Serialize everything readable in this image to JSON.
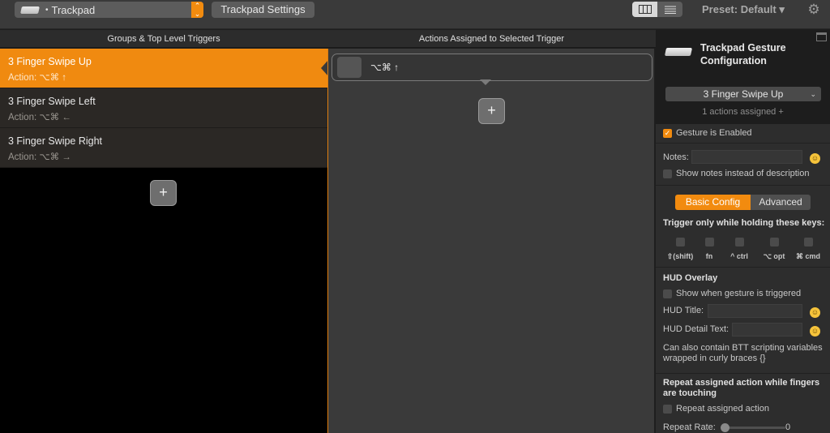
{
  "toolbar": {
    "source_select": {
      "dot": "•",
      "label": "Trackpad",
      "icon": "trackpad-icon"
    },
    "trackpad_settings_label": "Trackpad Settings",
    "view_toggle": [
      "columns-view-icon",
      "list-view-icon"
    ],
    "preset_label": "Preset: Default ▾",
    "settings_icon": "gear-icon"
  },
  "headers": {
    "left": "Groups & Top Level Triggers",
    "middle": "Actions Assigned to Selected Trigger"
  },
  "triggers": [
    {
      "title": "3 Finger Swipe Up",
      "action": "Action: ⌥⌘ ↑",
      "selected": true
    },
    {
      "title": "3 Finger Swipe Left",
      "action": "Action: ⌥⌘ ←",
      "selected": false
    },
    {
      "title": "3 Finger Swipe Right",
      "action": "Action: ⌥⌘ →",
      "selected": false
    }
  ],
  "add_button_label": "+",
  "actions": [
    {
      "shortcut": "⌥⌘ ↑"
    }
  ],
  "panel": {
    "title": "Trackpad Gesture Configuration",
    "gesture_select": "3 Finger Swipe Up",
    "actions_count": "1 actions assigned +",
    "gesture_enabled_label": "Gesture is Enabled",
    "gesture_enabled": true,
    "notes_label": "Notes:",
    "notes_value": "",
    "show_notes_label": "Show notes instead of description",
    "tabs": {
      "basic": "Basic Config",
      "advanced": "Advanced",
      "active": "basic"
    },
    "modifier_heading": "Trigger only while holding these keys:",
    "modifiers": [
      "⇧(shift)",
      "fn",
      "^ ctrl",
      "⌥ opt",
      "⌘ cmd"
    ],
    "hud_heading": "HUD Overlay",
    "hud_show_label": "Show when gesture is triggered",
    "hud_title_label": "HUD Title:",
    "hud_detail_label": "HUD Detail Text:",
    "hud_hint": "Can also contain BTT scripting variables wrapped in curly braces {}",
    "repeat_heading": "Repeat assigned action while fingers are touching",
    "repeat_label": "Repeat assigned action",
    "repeat_rate_label": "Repeat Rate:",
    "repeat_rate_value": "0"
  },
  "colors": {
    "accent": "#f28b0f",
    "background": "#000000",
    "panel": "#2d2d2d"
  }
}
